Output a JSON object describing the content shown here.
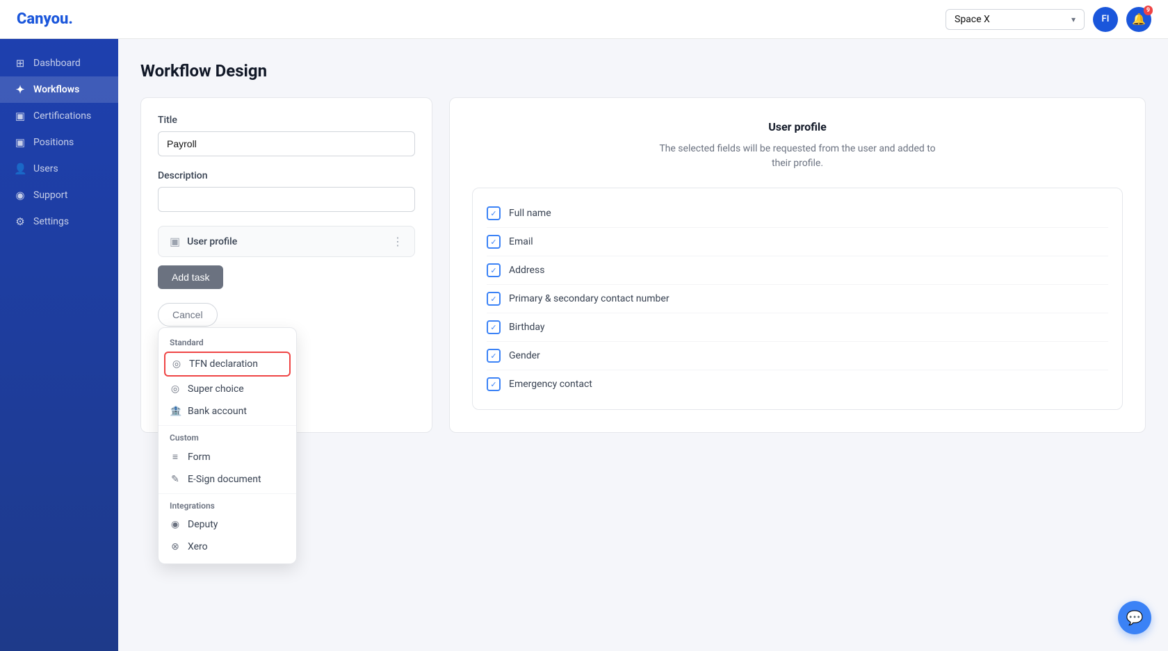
{
  "topbar": {
    "logo": "Canyou.",
    "workspace": "Space X",
    "avatar_initials": "FI",
    "notification_count": "9"
  },
  "sidebar": {
    "items": [
      {
        "id": "dashboard",
        "label": "Dashboard",
        "icon": "⊞"
      },
      {
        "id": "workflows",
        "label": "Workflows",
        "icon": "✦",
        "active": true
      },
      {
        "id": "certifications",
        "label": "Certifications",
        "icon": "▣"
      },
      {
        "id": "positions",
        "label": "Positions",
        "icon": "▣"
      },
      {
        "id": "users",
        "label": "Users",
        "icon": "👤"
      },
      {
        "id": "support",
        "label": "Support",
        "icon": "◉"
      },
      {
        "id": "settings",
        "label": "Settings",
        "icon": "⚙"
      }
    ]
  },
  "page": {
    "title": "Workflow Design"
  },
  "left_panel": {
    "title_label": "Title",
    "title_value": "Payroll",
    "title_placeholder": "",
    "description_label": "Description",
    "description_placeholder": "",
    "task_name": "User profile",
    "add_task_btn": "Add task",
    "cancel_btn": "Cancel"
  },
  "dropdown": {
    "standard_label": "Standard",
    "items_standard": [
      {
        "id": "tfn",
        "label": "TFN declaration",
        "icon": "◎",
        "highlighted": true
      },
      {
        "id": "super",
        "label": "Super choice",
        "icon": "◎"
      },
      {
        "id": "bank",
        "label": "Bank account",
        "icon": "🏦"
      }
    ],
    "custom_label": "Custom",
    "items_custom": [
      {
        "id": "form",
        "label": "Form",
        "icon": "≡"
      },
      {
        "id": "esign",
        "label": "E-Sign document",
        "icon": "✎"
      }
    ],
    "integrations_label": "Integrations",
    "items_integrations": [
      {
        "id": "deputy",
        "label": "Deputy",
        "icon": "◉"
      },
      {
        "id": "xero",
        "label": "Xero",
        "icon": "⊗"
      }
    ]
  },
  "right_panel": {
    "title": "User profile",
    "description": "The selected fields will be requested from the user and added to\ntheir profile.",
    "fields": [
      {
        "id": "full_name",
        "label": "Full name",
        "checked": true
      },
      {
        "id": "email",
        "label": "Email",
        "checked": true
      },
      {
        "id": "address",
        "label": "Address",
        "checked": true
      },
      {
        "id": "contact",
        "label": "Primary & secondary contact number",
        "checked": true
      },
      {
        "id": "birthday",
        "label": "Birthday",
        "checked": true
      },
      {
        "id": "gender",
        "label": "Gender",
        "checked": true
      },
      {
        "id": "emergency",
        "label": "Emergency contact",
        "checked": true
      }
    ]
  }
}
